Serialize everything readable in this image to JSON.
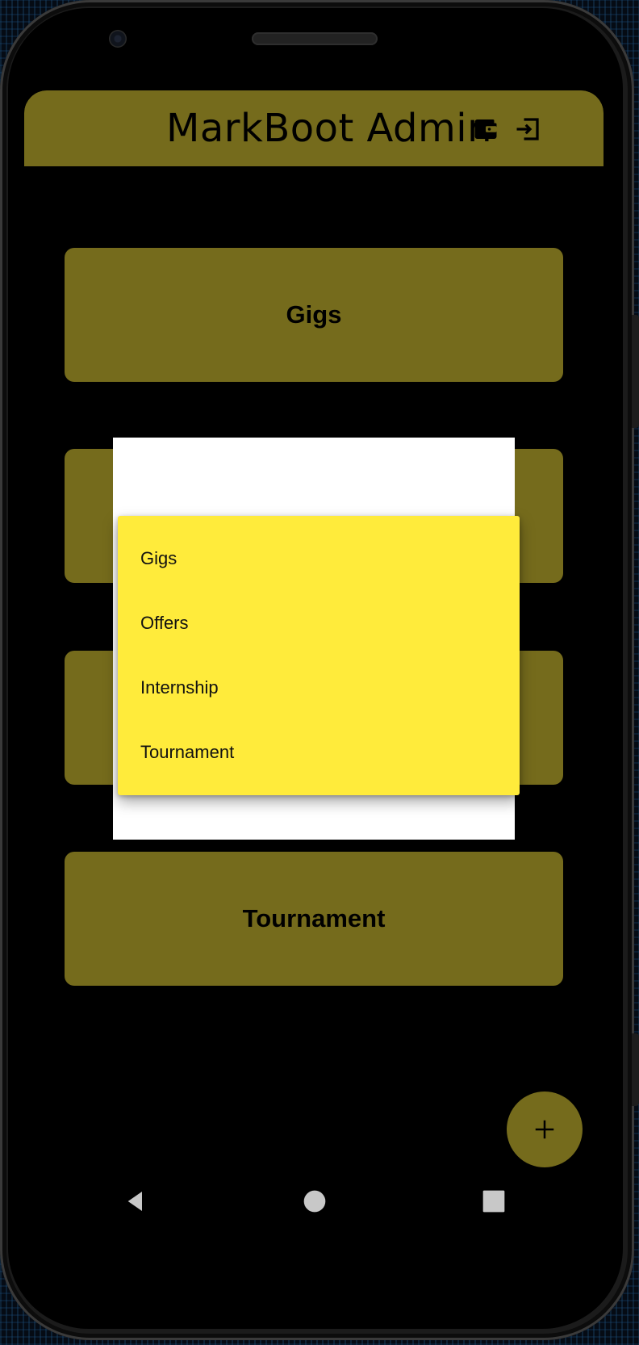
{
  "app": {
    "title": "MarkBoot Admin"
  },
  "appbar": {
    "wallet_icon": "wallet-icon",
    "logout_icon": "logout-icon"
  },
  "cards": [
    {
      "label": "Gigs"
    },
    {
      "label": ""
    },
    {
      "label": ""
    },
    {
      "label": "Tournament"
    }
  ],
  "dropdown_menu": {
    "items": [
      {
        "label": "Gigs"
      },
      {
        "label": "Offers"
      },
      {
        "label": "Internship"
      },
      {
        "label": "Tournament"
      }
    ]
  },
  "fab": {
    "icon": "plus-icon"
  },
  "system_nav": {
    "back_icon": "back-triangle-icon",
    "home_icon": "home-circle-icon",
    "recents_icon": "recents-square-icon"
  },
  "colors": {
    "accent": "#756b1c",
    "menu_background": "#ffeb3b",
    "dialog_background": "#ffffff",
    "screen_background": "#000000"
  }
}
